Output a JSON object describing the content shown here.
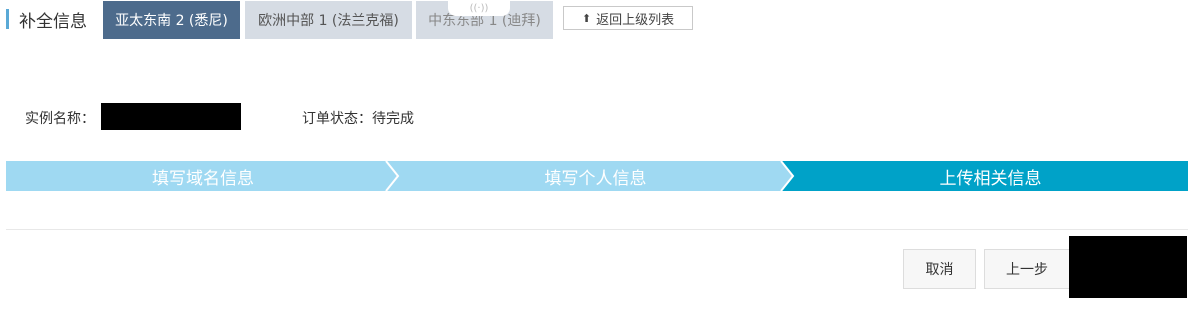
{
  "header": {
    "title": "补全信息",
    "tabs": [
      {
        "label": "亚太东南 2 (悉尼)",
        "active": true
      },
      {
        "label": "欧洲中部 1 (法兰克福)",
        "active": false
      },
      {
        "label": "中东东部 1 (迪拜)",
        "active": false
      }
    ],
    "back_label": "返回上级列表"
  },
  "info": {
    "instance_label": "实例名称：",
    "order_status_label": "订单状态：",
    "order_status_value": "待完成"
  },
  "steps": [
    {
      "label": "填写域名信息",
      "state": "done"
    },
    {
      "label": "填写个人信息",
      "state": "done"
    },
    {
      "label": "上传相关信息",
      "state": "current"
    }
  ],
  "actions": {
    "cancel_label": "取消",
    "prev_label": "上一步"
  },
  "colors": {
    "active_tab": "#4d6b8c",
    "inactive_tab": "#d6dce4",
    "step_done": "#9fd9f2",
    "step_current": "#00a2c8"
  }
}
